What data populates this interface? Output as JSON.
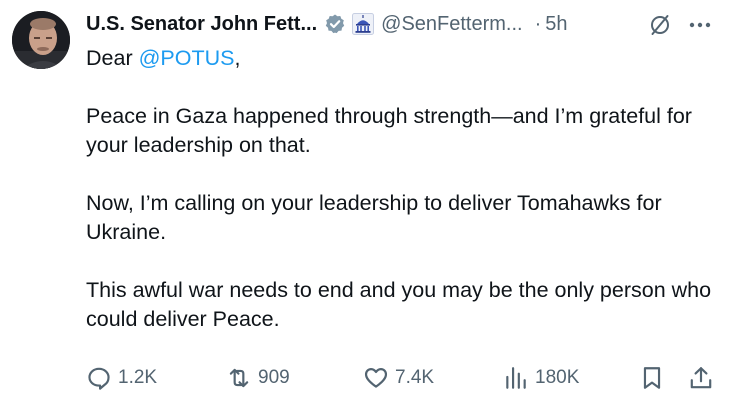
{
  "author": {
    "name": "U.S. Senator John Fett...",
    "handle": "@SenFetterm...",
    "time": "5h",
    "separator": "·"
  },
  "tweet": {
    "greeting_prefix": "Dear ",
    "mention": "@POTUS",
    "greeting_suffix": ",",
    "paragraphs": [
      "Peace in Gaza happened through strength—and I’m grateful for your leadership on that.",
      "Now, I’m calling on your leadership to deliver Tomahawks for Ukraine.",
      "This awful war needs to end and you may be the only person who could deliver Peace."
    ]
  },
  "actions": {
    "replies": "1.2K",
    "reposts": "909",
    "likes": "7.4K",
    "views": "180K"
  },
  "colors": {
    "text": "#0f1419",
    "secondary": "#536471",
    "link": "#1d9bf0",
    "verified_badge": "#829aab"
  },
  "icons": {
    "verified": "verified-badge-icon",
    "affiliation": "capitol-icon",
    "grok": "grok-icon",
    "more": "more-icon",
    "reply": "reply-icon",
    "repost": "repost-icon",
    "like": "heart-icon",
    "views": "views-icon",
    "bookmark": "bookmark-icon",
    "share": "share-icon"
  }
}
